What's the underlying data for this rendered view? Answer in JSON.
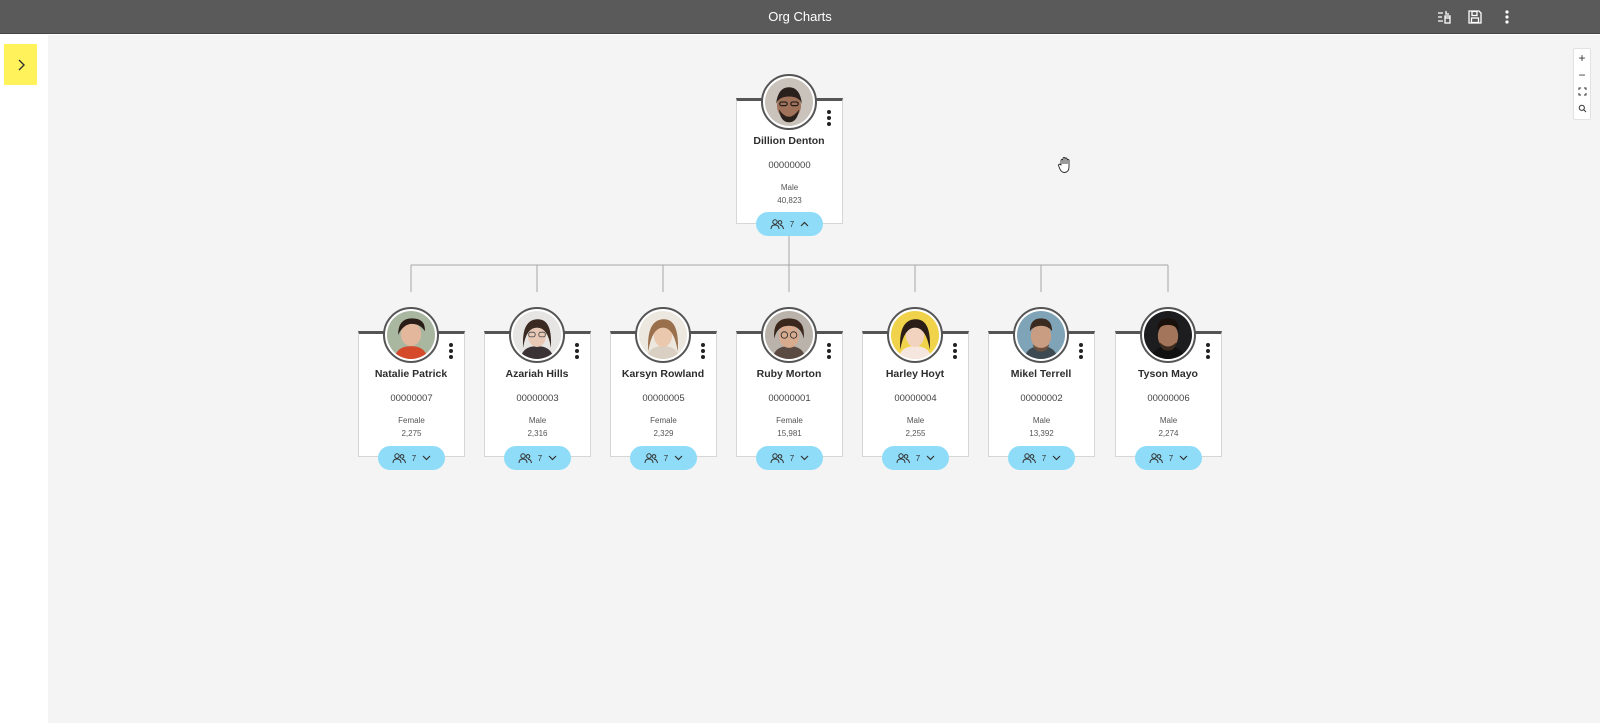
{
  "app": {
    "title": "Org Charts",
    "icons": [
      "sync-fields-icon",
      "save-icon",
      "more-vertical-icon"
    ]
  },
  "sidebar_toggle": {
    "icon": "chevron-right-icon",
    "color": "#fff25a"
  },
  "zoom_controls": [
    {
      "label": "+",
      "icon": "zoom-in-icon"
    },
    {
      "label": "−",
      "icon": "zoom-out-icon"
    },
    {
      "label": "",
      "icon": "fit-screen-icon"
    },
    {
      "label": "",
      "icon": "search-icon"
    }
  ],
  "colors": {
    "accent_pill": "#8fdcf8",
    "card_top_border": "#555555",
    "topbar": "#5a5a5a",
    "canvas": "#f4f4f4"
  },
  "root": {
    "name": "Dillion Denton",
    "id": "00000000",
    "gender": "Male",
    "value": "40,823",
    "reports": "7",
    "expanded": true
  },
  "children": [
    {
      "name": "Natalie Patrick",
      "id": "00000007",
      "gender": "Female",
      "value": "2,275",
      "reports": "7"
    },
    {
      "name": "Azariah Hills",
      "id": "00000003",
      "gender": "Male",
      "value": "2,316",
      "reports": "7"
    },
    {
      "name": "Karsyn Rowland",
      "id": "00000005",
      "gender": "Female",
      "value": "2,329",
      "reports": "7"
    },
    {
      "name": "Ruby Morton",
      "id": "00000001",
      "gender": "Female",
      "value": "15,981",
      "reports": "7"
    },
    {
      "name": "Harley Hoyt",
      "id": "00000004",
      "gender": "Male",
      "value": "2,255",
      "reports": "7"
    },
    {
      "name": "Mikel Terrell",
      "id": "00000002",
      "gender": "Male",
      "value": "13,392",
      "reports": "7"
    },
    {
      "name": "Tyson Mayo",
      "id": "00000006",
      "gender": "Male",
      "value": "2,274",
      "reports": "7"
    }
  ]
}
